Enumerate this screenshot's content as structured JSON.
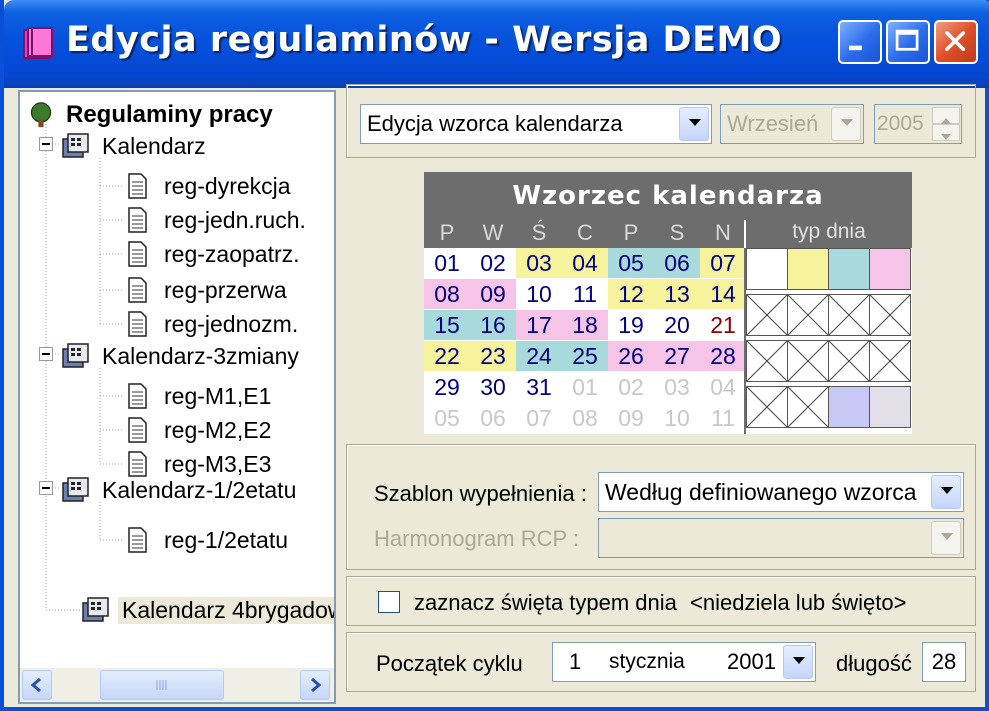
{
  "window": {
    "title": "Edycja regulaminów - Wersja DEMO"
  },
  "tree": {
    "root": "Regulaminy pracy",
    "items": [
      {
        "label": "Kalendarz"
      },
      {
        "label": "reg-dyrekcja"
      },
      {
        "label": "reg-jedn.ruch."
      },
      {
        "label": "reg-zaopatrz."
      },
      {
        "label": "reg-przerwa"
      },
      {
        "label": "reg-jednozm."
      },
      {
        "label": "Kalendarz-3zmiany"
      },
      {
        "label": "reg-M1,E1"
      },
      {
        "label": "reg-M2,E2"
      },
      {
        "label": "reg-M3,E3"
      },
      {
        "label": "Kalendarz-1/2etatu"
      },
      {
        "label": "reg-1/2etatu"
      },
      {
        "label": "Kalendarz 4brygadow"
      }
    ]
  },
  "top": {
    "mode": "Edycja wzorca kalendarza",
    "month": "Wrzesień",
    "year": "2005"
  },
  "calendar": {
    "title": "Wzorzec kalendarza",
    "weekdays": [
      "P",
      "W",
      "Ś",
      "C",
      "P",
      "S",
      "N"
    ],
    "typ_header": "typ dnia",
    "weeks": [
      [
        "01",
        "02",
        "03",
        "04",
        "05",
        "06",
        "07"
      ],
      [
        "08",
        "09",
        "10",
        "11",
        "12",
        "13",
        "14"
      ],
      [
        "15",
        "16",
        "17",
        "18",
        "19",
        "20",
        "21"
      ],
      [
        "22",
        "23",
        "24",
        "25",
        "26",
        "27",
        "28"
      ],
      [
        "29",
        "30",
        "31",
        "01",
        "02",
        "03",
        "04"
      ],
      [
        "05",
        "06",
        "07",
        "08",
        "09",
        "10",
        "11"
      ]
    ],
    "colors": {
      "white": "#ffffff",
      "yellow": "#f6f39c",
      "cyan": "#a8dadc",
      "pink": "#f6c4e6",
      "lavender": "#c8c8f4",
      "lightgray": "#e2dfe9",
      "muted": "#c8c8c8",
      "text": "#000080",
      "sunday": "#8b0000"
    }
  },
  "fill": {
    "szablon_label": "Szablon wypełnienia :",
    "szablon_value": "Według definiowanego wzorca",
    "harmonogram_label": "Harmonogram RCP :",
    "harmonogram_value": ""
  },
  "holiday": {
    "checkbox_label": "zaznacz święta  typem dnia",
    "type_value": "<niedziela lub święto>"
  },
  "cycle": {
    "start_label": "Początek cyklu",
    "day": "1",
    "month": "stycznia",
    "year": "2001",
    "length_label": "długość",
    "length": "28"
  }
}
